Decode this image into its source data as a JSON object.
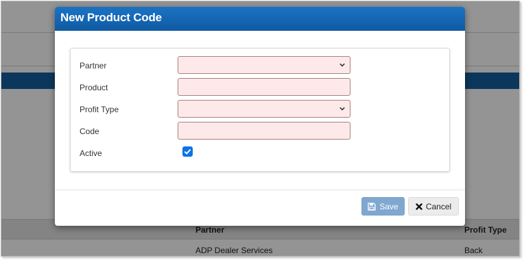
{
  "background": {
    "table_headers": {
      "partner": "Partner",
      "profit_type": "Profit Type"
    },
    "row": {
      "partner": "ADP Dealer Services",
      "profit_type": "Back"
    }
  },
  "modal": {
    "title": "New Product Code",
    "form": {
      "partner": {
        "label": "Partner",
        "value": ""
      },
      "product": {
        "label": "Product",
        "value": ""
      },
      "profit_type": {
        "label": "Profit Type",
        "value": ""
      },
      "code": {
        "label": "Code",
        "value": ""
      },
      "active": {
        "label": "Active",
        "checked": true
      }
    },
    "buttons": {
      "save": "Save",
      "cancel": "Cancel"
    }
  },
  "icons": {
    "save": "floppy-disk-icon",
    "cancel": "x-icon",
    "select": "chevron-down-icon",
    "check": "checkmark-icon"
  },
  "colors": {
    "header": "#1467b4",
    "required_field_bg": "#fde9e9",
    "save_button": "#7fa7cf",
    "checkbox": "#0b73e6"
  }
}
